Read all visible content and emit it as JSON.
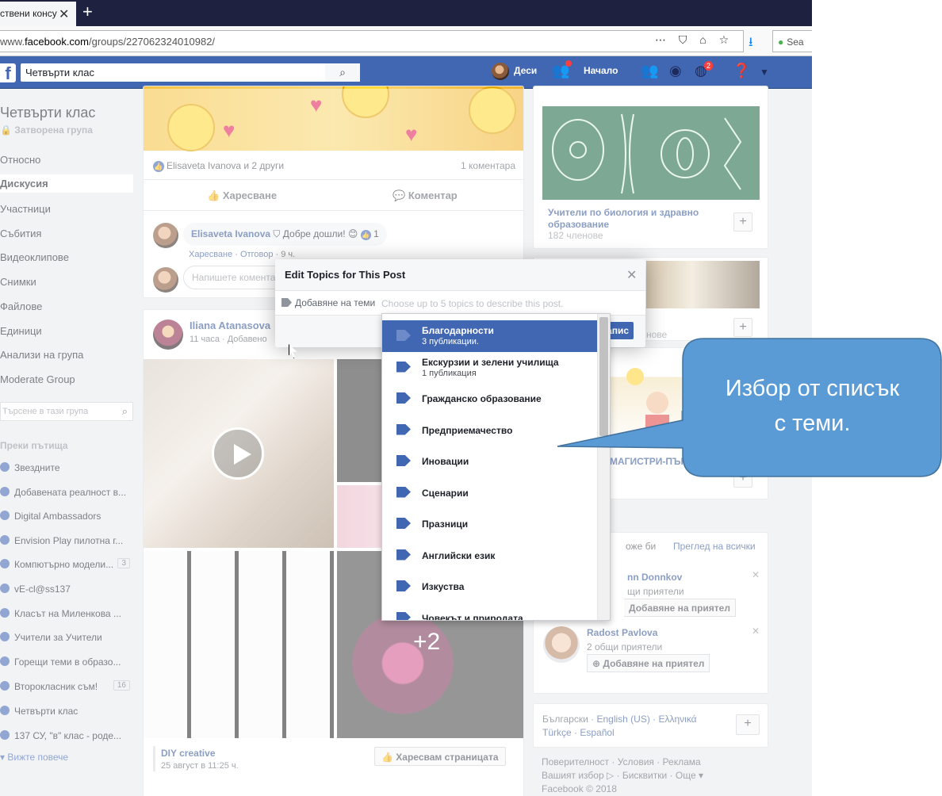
{
  "browser": {
    "tab_title": "ствени консу",
    "url_prefix": "www.",
    "url_host": "facebook.com",
    "url_path": "/groups/227062324010982/",
    "search_placeholder": "Sea"
  },
  "fbbar": {
    "search_value": "Четвърти клас",
    "user_name": "Деси",
    "home_label": "Начало",
    "notif_badge": "2"
  },
  "group": {
    "title": "Четвърти клас",
    "privacy": "Затворена група",
    "nav": [
      "Относно",
      "Дискусия",
      "Участници",
      "Събития",
      "Видеоклипове",
      "Снимки",
      "Файлове",
      "Единици",
      "Анализи на група",
      "Moderate Group"
    ],
    "search_placeholder": "Търсене в тази група",
    "shortcuts_title": "Преки пътища",
    "shortcuts": [
      {
        "label": "Звездните",
        "count": ""
      },
      {
        "label": "Добавената реалност в...",
        "count": ""
      },
      {
        "label": "Digital Ambassadors",
        "count": ""
      },
      {
        "label": "Envision Play пилотна г...",
        "count": ""
      },
      {
        "label": "Компютърно модели...",
        "count": "3"
      },
      {
        "label": "vE-cl@ss137",
        "count": ""
      },
      {
        "label": "Класът на Миленкова ...",
        "count": ""
      },
      {
        "label": "Учители за Учители",
        "count": ""
      },
      {
        "label": "Горещи теми в образо...",
        "count": ""
      },
      {
        "label": "Второкласник съм!",
        "count": "16"
      },
      {
        "label": "Четвърти клас",
        "count": ""
      },
      {
        "label": "137 СУ, \"в\" клас - роде...",
        "count": ""
      }
    ],
    "see_more": "Вижте повече"
  },
  "post1": {
    "likes": "Elisaveta Ivanova и 2 други",
    "comments": "1 коментара",
    "like_label": "Харесване",
    "comment_label": "Коментар",
    "comment_author": "Elisaveta Ivanova",
    "comment_text": "Добре дошли! 😊",
    "comment_likes": "1",
    "reply_meta_like": "Харесване",
    "reply_meta_reply": "Отговор",
    "reply_meta_time": "9 ч.",
    "write_comment": "Напишете коментар..."
  },
  "post2": {
    "author": "Iliana Atanasova",
    "meta": "11 часа · Добавено",
    "more_photos": "+2",
    "source_name": "DIY creative",
    "source_date": "25 август в 11:25 ч.",
    "like_page": "Харесвам страницата"
  },
  "right": {
    "group1_title": "Учители по биология и здравно образование",
    "group1_members": "182 членове",
    "group2_members_tail": "нове",
    "group3_title_tail": "МАГИСТРИ-ПЪРВ",
    "pymk_title_tail": "оже би",
    "see_all": "Преглед на всички",
    "friend1_name": "nn Donnkov",
    "friend1_mutual": "щи приятели",
    "friend1_btn": "Добавяне на приятел",
    "friend2_name": "Radost Pavlova",
    "friend2_mutual": "2 общи приятели",
    "friend2_btn": "Добавяне на приятел",
    "languages_1": "Български · ",
    "languages_2": "English (US) · Ελληνικά",
    "languages_3": "Türkçe · Español",
    "footer_1": "Поверителност · Условия · Реклама",
    "footer_2": "Вашият избор ▷ · Бисквитки · Още ▾",
    "footer_3": "Facebook © 2018"
  },
  "dialog": {
    "title": "Edit Topics for This Post",
    "topics_label": "Добавяне на теми",
    "topics_placeholder": "Choose up to 5 topics to describe this post.",
    "save_label": "Запис"
  },
  "topics": [
    {
      "name": "Благодарности",
      "count": "3 публикации.",
      "selected": true
    },
    {
      "name": "Екскурзии и зелени училища",
      "count": "1 публикация",
      "selected": false
    },
    {
      "name": "Гражданско образование",
      "count": "",
      "selected": false
    },
    {
      "name": "Предприемачество",
      "count": "",
      "selected": false
    },
    {
      "name": "Иновации",
      "count": "",
      "selected": false
    },
    {
      "name": "Сценарии",
      "count": "",
      "selected": false
    },
    {
      "name": "Празници",
      "count": "",
      "selected": false
    },
    {
      "name": "Английски език",
      "count": "",
      "selected": false
    },
    {
      "name": "Изкуства",
      "count": "",
      "selected": false
    },
    {
      "name": "Човекът и природата",
      "count": "",
      "selected": false
    }
  ],
  "callout": {
    "line1": "Избор от списък",
    "line2": "с теми."
  },
  "colors": {
    "fb_blue": "#4267b2",
    "callout_fill": "#5b9bd5",
    "callout_border": "#41719c"
  }
}
